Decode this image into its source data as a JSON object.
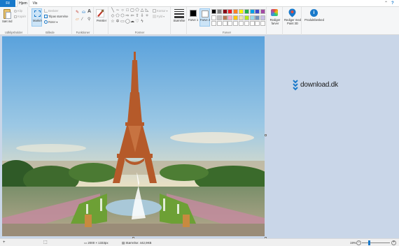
{
  "tabs": {
    "file": "Fil",
    "home": "Hjem",
    "view": "Vis"
  },
  "ribbon": {
    "clipboard": {
      "paste": "Sæt ind",
      "cut": "Klip",
      "copy": "Kopiér",
      "group": "Udklipsholder"
    },
    "image": {
      "select": "Markér",
      "crop": "Beskær",
      "resize": "Tilpas størrelse",
      "rotate": "Roter",
      "group": "Billede"
    },
    "tools": {
      "group": "Funktioner"
    },
    "brushes": {
      "label": "Pensler"
    },
    "shapes": {
      "outline": "Kontur",
      "fill": "Fyld",
      "group": "Former"
    },
    "size": {
      "label": "Størrelse"
    },
    "colors": {
      "color1": "Farve 1",
      "color2": "Farve 2",
      "group": "Farver",
      "edit": "Rediger farver"
    },
    "paint3d": "Rediger med Paint 3D",
    "alert": "Produktbesked",
    "palette": [
      "#000000",
      "#7f7f7f",
      "#880015",
      "#ed1c24",
      "#ff7f27",
      "#fff200",
      "#22b14c",
      "#00a2e8",
      "#3f48cc",
      "#a349a4",
      "#ffffff",
      "#c3c3c3",
      "#b97a57",
      "#ffaec9",
      "#ffc90e",
      "#efe4b0",
      "#b5e61d",
      "#99d9ea",
      "#7092be",
      "#c8bfe7",
      "#ffffff",
      "#ffffff",
      "#ffffff",
      "#ffffff",
      "#ffffff",
      "#ffffff",
      "#ffffff",
      "#ffffff",
      "#ffffff",
      "#ffffff"
    ]
  },
  "watermark": {
    "text": "download.dk"
  },
  "status": {
    "dimensions": "2000 × 1333px",
    "filesize": "Størrelse: 442,9KB",
    "zoom": "19%",
    "zoom_level": 0.19
  },
  "colors": {
    "accent": "#1979ca",
    "ribbon_bg": "#f5f6f7",
    "workspace_bg": "#c9d6e8"
  }
}
